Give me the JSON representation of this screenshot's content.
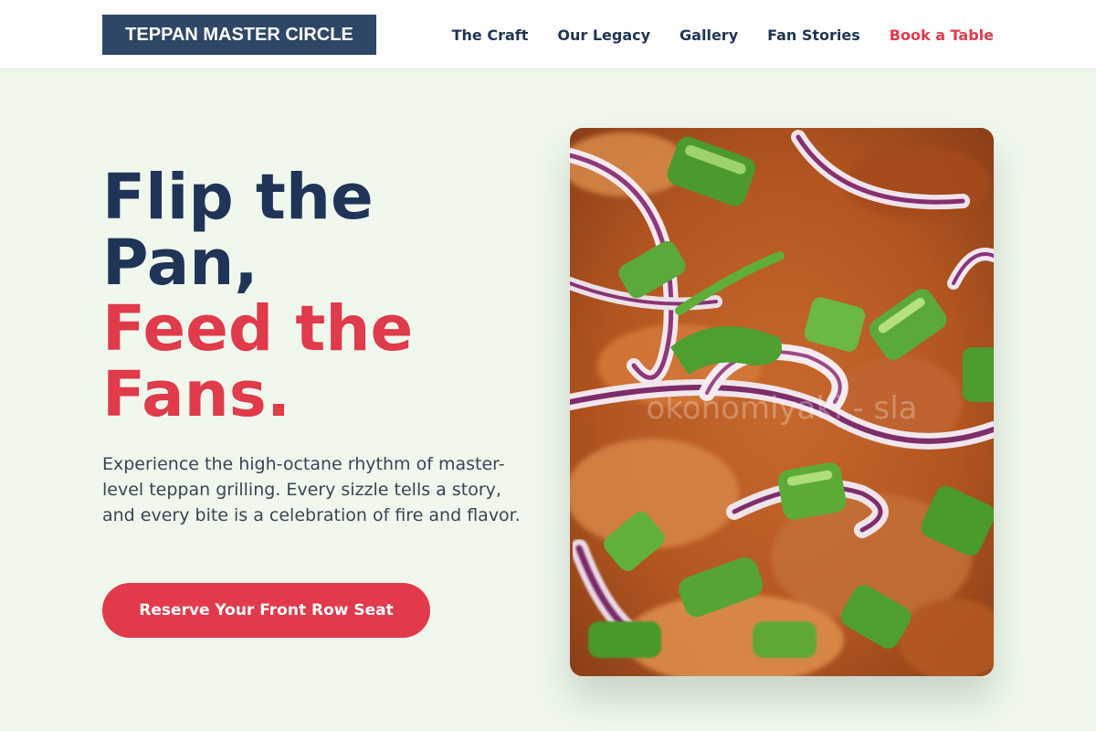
{
  "brand": {
    "logo_text": "TEPPAN MASTER CIRCLE"
  },
  "nav": {
    "items": [
      {
        "label": "The Craft"
      },
      {
        "label": "Our Legacy"
      },
      {
        "label": "Gallery"
      },
      {
        "label": "Fan Stories"
      },
      {
        "label": "Book a Table"
      }
    ]
  },
  "hero": {
    "headline_lines": [
      "Flip the",
      "Pan,",
      "Feed the",
      "Fans."
    ],
    "description": "Experience the high-octane rhythm of master-level teppan grilling. Every sizzle tells a story, and every bite is a celebration of fire and flavor.",
    "cta_label": "Reserve Your Front Row Seat",
    "image_watermark": "okonomiyaki - sla"
  },
  "colors": {
    "navy": "#1f3456",
    "logo_bg": "#2f4766",
    "accent_red": "#e03a4b",
    "page_bg": "#f0f8ee"
  }
}
